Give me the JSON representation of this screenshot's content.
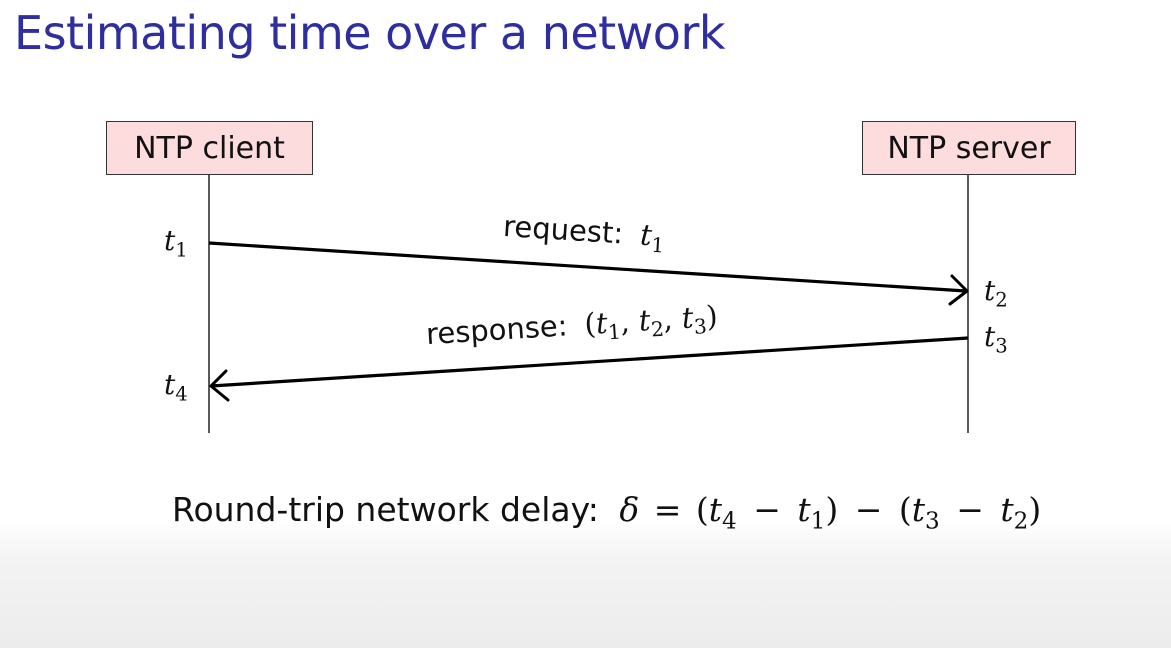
{
  "slide": {
    "title": "Estimating time over a network"
  },
  "actors": {
    "client": "NTP client",
    "server": "NTP server"
  },
  "timestamps": {
    "t1": {
      "var": "t",
      "sub": "1"
    },
    "t2": {
      "var": "t",
      "sub": "2"
    },
    "t3": {
      "var": "t",
      "sub": "3"
    },
    "t4": {
      "var": "t",
      "sub": "4"
    }
  },
  "messages": {
    "request": {
      "label": "request:",
      "payload": {
        "var": "t",
        "sub": "1"
      }
    },
    "response": {
      "label": "response:",
      "payload_open": "(",
      "payload_close": ")",
      "payload": [
        {
          "var": "t",
          "sub": "1"
        },
        {
          "var": "t",
          "sub": "2"
        },
        {
          "var": "t",
          "sub": "3"
        }
      ]
    }
  },
  "formula": {
    "label": "Round-trip network delay:",
    "symbol": "δ",
    "equals": "=",
    "expression": "(t4 − t1) − (t3 − t2)"
  }
}
